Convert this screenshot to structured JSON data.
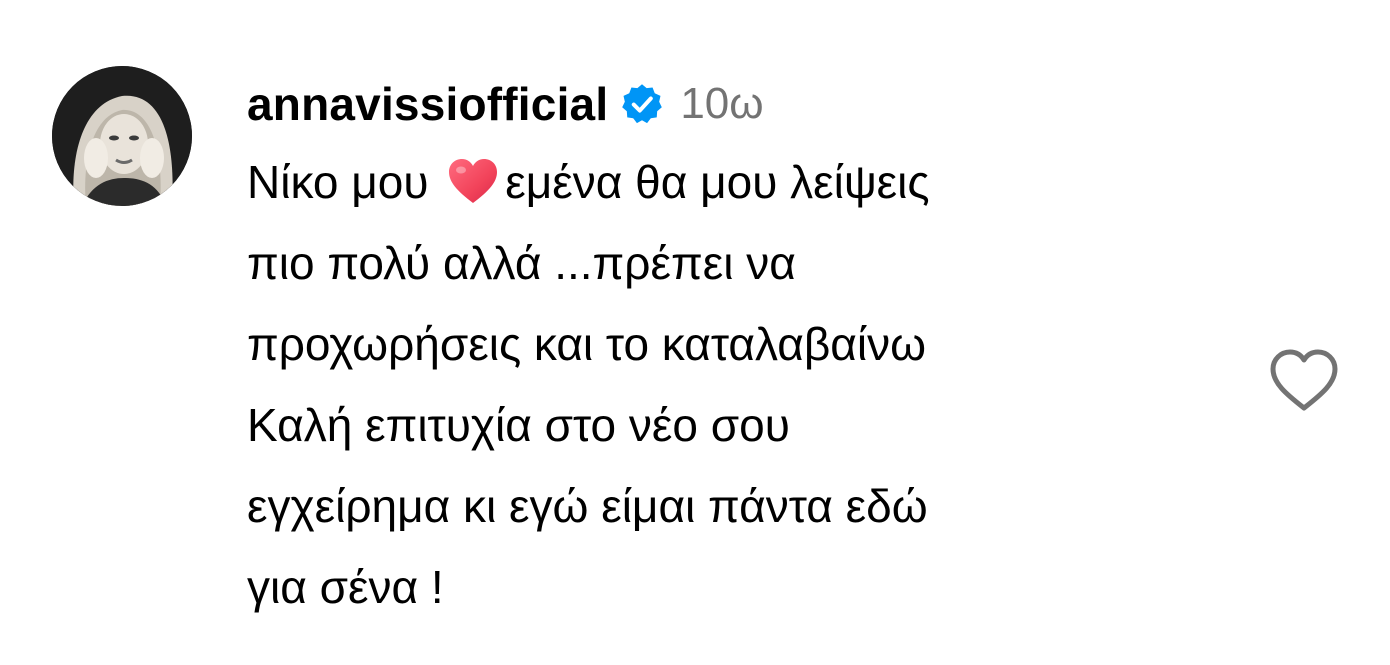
{
  "comment": {
    "author": {
      "username": "annavissiofficial",
      "verified": true,
      "avatar_icon": "profile-photo"
    },
    "timestamp": "10ω",
    "text_lines": [
      {
        "before_emoji": "Νίκο μου ",
        "emoji": "red-heart",
        "after_emoji": "εμένα θα μου λείψεις"
      },
      {
        "text": "πιο πολύ αλλά ...πρέπει να"
      },
      {
        "text": "προχωρήσεις και το καταλαβαίνω"
      },
      {
        "text": "Καλή επιτυχία στο νέο σου"
      },
      {
        "text": "εγχείρημα κι εγώ είμαι πάντα εδώ"
      },
      {
        "text": "για σένα !"
      }
    ],
    "like_icon": "heart-outline-icon"
  },
  "colors": {
    "verified_badge": "#0095f6",
    "timestamp": "#737373",
    "like_icon": "#737373",
    "emoji_heart": "#f2435a"
  }
}
